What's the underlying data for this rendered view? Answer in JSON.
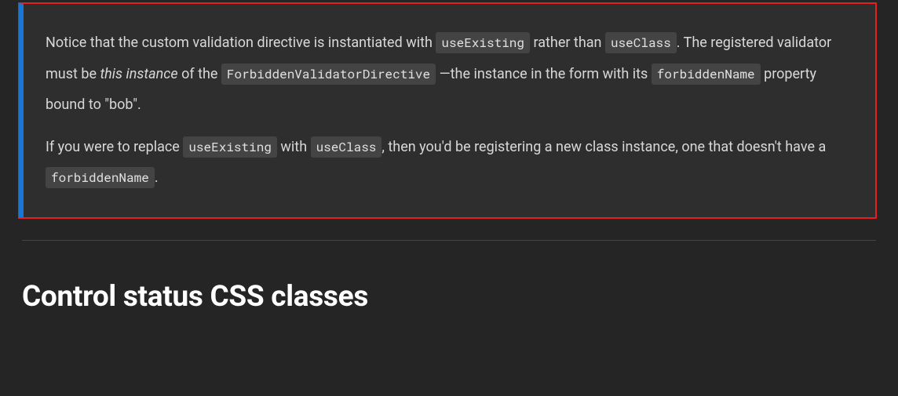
{
  "callout": {
    "p1": {
      "t1": "Notice that the custom validation directive is instantiated with ",
      "c1": "useExisting",
      "t2": " rather than ",
      "c2": "useClass",
      "t3": ". The registered validator must be ",
      "em": "this instance",
      "t4": " of the ",
      "c3": "ForbiddenValidatorDirective",
      "t5": " —the instance in the form with its ",
      "c4": "forbiddenName",
      "t6": " property bound to \"bob\"."
    },
    "p2": {
      "t1": "If you were to replace ",
      "c1": "useExisting",
      "t2": " with ",
      "c2": "useClass",
      "t3": ", then you'd be registering a new class instance, one that doesn't have a ",
      "c3": "forbiddenName",
      "t4": "."
    }
  },
  "heading": "Control status CSS classes"
}
